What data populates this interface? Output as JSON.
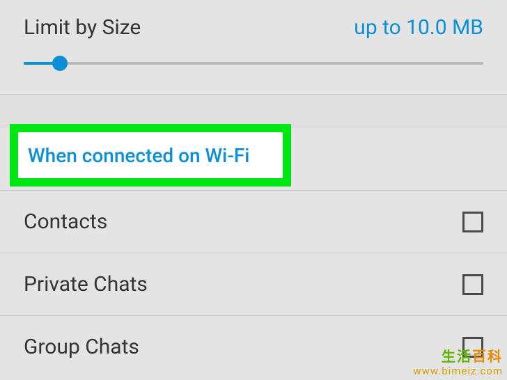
{
  "limit": {
    "label": "Limit by Size",
    "value": "up to 10.0 MB"
  },
  "section": {
    "header": "When connected on Wi-Fi"
  },
  "rows": [
    {
      "label": "Contacts"
    },
    {
      "label": "Private Chats"
    },
    {
      "label": "Group Chats"
    }
  ],
  "watermark": {
    "line1_a": "生活",
    "line1_b": "百科",
    "line2": "www.bimeiz.com"
  }
}
